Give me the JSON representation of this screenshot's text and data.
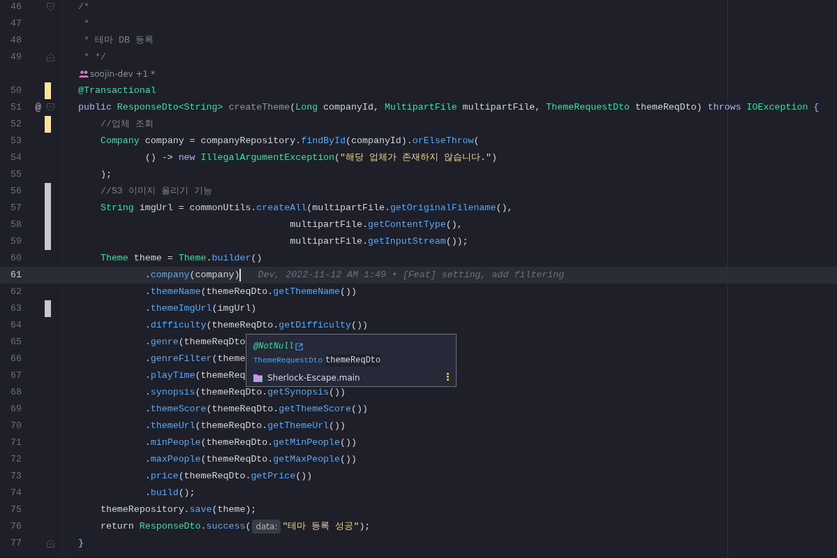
{
  "editor": {
    "lines": [
      {
        "kind": "code",
        "number": "46",
        "fold": {
          "kind": "start"
        },
        "current": false,
        "tokens": [
          {
            "kind": "comment",
            "text": "/*"
          }
        ]
      },
      {
        "kind": "code",
        "number": "47",
        "current": false,
        "tokens": [
          {
            "kind": "comment",
            "text": " *"
          }
        ]
      },
      {
        "kind": "code",
        "number": "48",
        "current": false,
        "tokens": [
          {
            "kind": "comment",
            "text": " * 테마 DB 등록"
          }
        ]
      },
      {
        "kind": "code",
        "number": "49",
        "fold": {
          "kind": "end"
        },
        "current": false,
        "tokens": [
          {
            "kind": "comment",
            "text": " * */"
          }
        ]
      },
      {
        "kind": "author",
        "text": "soojin-dev +1 *"
      },
      {
        "kind": "code",
        "number": "50",
        "change": {
          "color": "#fde29a"
        },
        "current": false,
        "tokens": [
          {
            "kind": "annotation",
            "text": "@Transactional"
          }
        ]
      },
      {
        "kind": "code",
        "number": "51",
        "marker": "@",
        "fold": {
          "kind": "start"
        },
        "current": false,
        "tokens": [
          {
            "kind": "keyword",
            "text": "public "
          },
          {
            "kind": "type",
            "text": "ResponseDto<String>"
          },
          {
            "kind": "declaration",
            "text": " createTheme"
          },
          {
            "kind": "plain",
            "text": "("
          },
          {
            "kind": "type",
            "text": "Long"
          },
          {
            "kind": "plain",
            "text": " companyId, "
          },
          {
            "kind": "type",
            "text": "MultipartFile"
          },
          {
            "kind": "plain",
            "text": " multipartFile, "
          },
          {
            "kind": "type",
            "text": "ThemeRequestDto"
          },
          {
            "kind": "plain",
            "text": " themeReqDto) "
          },
          {
            "kind": "keyword",
            "text": "throws "
          },
          {
            "kind": "type",
            "text": "IOException"
          },
          {
            "kind": "keyword",
            "text": " {"
          }
        ]
      },
      {
        "kind": "code",
        "number": "52",
        "change": {
          "color": "#fde29a"
        },
        "current": false,
        "tokens": [
          {
            "kind": "comment",
            "text": "    //업체 조회"
          }
        ]
      },
      {
        "kind": "code",
        "number": "53",
        "current": false,
        "tokens": [
          {
            "kind": "type",
            "text": "    Company"
          },
          {
            "kind": "plain",
            "text": " company = companyRepository."
          },
          {
            "kind": "method",
            "text": "findById"
          },
          {
            "kind": "plain",
            "text": "(companyId)."
          },
          {
            "kind": "method",
            "text": "orElseThrow"
          },
          {
            "kind": "plain",
            "text": "("
          }
        ]
      },
      {
        "kind": "code",
        "number": "54",
        "current": false,
        "tokens": [
          {
            "kind": "plain",
            "text": "            () -> "
          },
          {
            "kind": "keyword",
            "text": "new "
          },
          {
            "kind": "type",
            "text": "IllegalArgumentException"
          },
          {
            "kind": "plain",
            "text": "("
          },
          {
            "kind": "string",
            "text": "\"해당 업체가 존재하지 않습니다.\""
          },
          {
            "kind": "plain",
            "text": ")"
          }
        ]
      },
      {
        "kind": "code",
        "number": "55",
        "current": false,
        "tokens": [
          {
            "kind": "plain",
            "text": "    );"
          }
        ]
      },
      {
        "kind": "code",
        "number": "56",
        "change": {
          "color": "#c7c9cc"
        },
        "current": false,
        "tokens": [
          {
            "kind": "comment",
            "text": "    //S3 이미지 올리기 기능"
          }
        ]
      },
      {
        "kind": "code",
        "number": "57",
        "change": {
          "color": "#c7c9cc"
        },
        "current": false,
        "tokens": [
          {
            "kind": "type",
            "text": "    String"
          },
          {
            "kind": "plain",
            "text": " imgUrl = commonUtils."
          },
          {
            "kind": "method",
            "text": "createAll"
          },
          {
            "kind": "plain",
            "text": "(multipartFile."
          },
          {
            "kind": "method",
            "text": "getOriginalFilename"
          },
          {
            "kind": "plain",
            "text": "(),"
          }
        ]
      },
      {
        "kind": "code",
        "number": "58",
        "change": {
          "color": "#c7c9cc"
        },
        "current": false,
        "tokens": [
          {
            "kind": "plain",
            "text": "                                      multipartFile."
          },
          {
            "kind": "method",
            "text": "getContentType"
          },
          {
            "kind": "plain",
            "text": "(),"
          }
        ]
      },
      {
        "kind": "code",
        "number": "59",
        "change": {
          "color": "#c7c9cc"
        },
        "current": false,
        "tokens": [
          {
            "kind": "plain",
            "text": "                                      multipartFile."
          },
          {
            "kind": "method",
            "text": "getInputStream"
          },
          {
            "kind": "plain",
            "text": "());"
          }
        ]
      },
      {
        "kind": "code",
        "number": "60",
        "current": false,
        "tokens": [
          {
            "kind": "type",
            "text": "    Theme"
          },
          {
            "kind": "plain",
            "text": " theme = "
          },
          {
            "kind": "type",
            "text": "Theme"
          },
          {
            "kind": "plain",
            "text": "."
          },
          {
            "kind": "method",
            "text": "builder"
          },
          {
            "kind": "plain",
            "text": "()"
          }
        ]
      },
      {
        "kind": "code",
        "number": "61",
        "current": true,
        "blame": "Dev, 2022-11-12 AM 1:49 • [Feat] setting, add filtering",
        "tokens": [
          {
            "kind": "plain",
            "text": "            ."
          },
          {
            "kind": "method",
            "text": "company"
          },
          {
            "kind": "plain",
            "text": "(company)"
          }
        ]
      },
      {
        "kind": "code",
        "number": "62",
        "current": false,
        "tokens": [
          {
            "kind": "plain",
            "text": "            ."
          },
          {
            "kind": "method",
            "text": "themeName"
          },
          {
            "kind": "plain",
            "text": "(themeReqDto."
          },
          {
            "kind": "method",
            "text": "getThemeName"
          },
          {
            "kind": "plain",
            "text": "())"
          }
        ]
      },
      {
        "kind": "code",
        "number": "63",
        "change": {
          "color": "#c7c9cc"
        },
        "current": false,
        "tokens": [
          {
            "kind": "plain",
            "text": "            ."
          },
          {
            "kind": "method",
            "text": "themeImgUrl"
          },
          {
            "kind": "plain",
            "text": "(imgUrl)"
          }
        ]
      },
      {
        "kind": "code",
        "number": "64",
        "current": false,
        "tokens": [
          {
            "kind": "plain",
            "text": "            ."
          },
          {
            "kind": "method",
            "text": "difficulty"
          },
          {
            "kind": "plain",
            "text": "(themeReqDto."
          },
          {
            "kind": "method",
            "text": "getDifficulty"
          },
          {
            "kind": "plain",
            "text": "())"
          }
        ]
      },
      {
        "kind": "code",
        "number": "65",
        "current": false,
        "tokens": [
          {
            "kind": "plain",
            "text": "            ."
          },
          {
            "kind": "method",
            "text": "genre"
          },
          {
            "kind": "plain",
            "text": "(themeReqDto"
          }
        ]
      },
      {
        "kind": "code",
        "number": "66",
        "current": false,
        "tokens": [
          {
            "kind": "plain",
            "text": "            ."
          },
          {
            "kind": "method",
            "text": "genreFilter"
          },
          {
            "kind": "plain",
            "text": "(theme"
          }
        ]
      },
      {
        "kind": "code",
        "number": "67",
        "current": false,
        "tokens": [
          {
            "kind": "plain",
            "text": "            ."
          },
          {
            "kind": "method",
            "text": "playTime"
          },
          {
            "kind": "plain",
            "text": "(themeReq"
          }
        ]
      },
      {
        "kind": "code",
        "number": "68",
        "current": false,
        "tokens": [
          {
            "kind": "plain",
            "text": "            ."
          },
          {
            "kind": "method",
            "text": "synopsis"
          },
          {
            "kind": "plain",
            "text": "(themeReqDto."
          },
          {
            "kind": "method",
            "text": "getSynopsis"
          },
          {
            "kind": "plain",
            "text": "())"
          }
        ]
      },
      {
        "kind": "code",
        "number": "69",
        "current": false,
        "tokens": [
          {
            "kind": "plain",
            "text": "            ."
          },
          {
            "kind": "method",
            "text": "themeScore"
          },
          {
            "kind": "plain",
            "text": "(themeReqDto."
          },
          {
            "kind": "method",
            "text": "getThemeScore"
          },
          {
            "kind": "plain",
            "text": "())"
          }
        ]
      },
      {
        "kind": "code",
        "number": "70",
        "current": false,
        "tokens": [
          {
            "kind": "plain",
            "text": "            ."
          },
          {
            "kind": "method",
            "text": "themeUrl"
          },
          {
            "kind": "plain",
            "text": "(themeReqDto."
          },
          {
            "kind": "method",
            "text": "getThemeUrl"
          },
          {
            "kind": "plain",
            "text": "())"
          }
        ]
      },
      {
        "kind": "code",
        "number": "71",
        "current": false,
        "tokens": [
          {
            "kind": "plain",
            "text": "            ."
          },
          {
            "kind": "method",
            "text": "minPeople"
          },
          {
            "kind": "plain",
            "text": "(themeReqDto."
          },
          {
            "kind": "method",
            "text": "getMinPeople"
          },
          {
            "kind": "plain",
            "text": "())"
          }
        ]
      },
      {
        "kind": "code",
        "number": "72",
        "current": false,
        "tokens": [
          {
            "kind": "plain",
            "text": "            ."
          },
          {
            "kind": "method",
            "text": "maxPeople"
          },
          {
            "kind": "plain",
            "text": "(themeReqDto."
          },
          {
            "kind": "method",
            "text": "getMaxPeople"
          },
          {
            "kind": "plain",
            "text": "())"
          }
        ]
      },
      {
        "kind": "code",
        "number": "73",
        "current": false,
        "tokens": [
          {
            "kind": "plain",
            "text": "            ."
          },
          {
            "kind": "method",
            "text": "price"
          },
          {
            "kind": "plain",
            "text": "(themeReqDto."
          },
          {
            "kind": "method",
            "text": "getPrice"
          },
          {
            "kind": "plain",
            "text": "())"
          }
        ]
      },
      {
        "kind": "code",
        "number": "74",
        "current": false,
        "tokens": [
          {
            "kind": "plain",
            "text": "            ."
          },
          {
            "kind": "method",
            "text": "build"
          },
          {
            "kind": "plain",
            "text": "();"
          }
        ]
      },
      {
        "kind": "code",
        "number": "75",
        "current": false,
        "tokens": [
          {
            "kind": "plain",
            "text": "    themeRepository."
          },
          {
            "kind": "method",
            "text": "save"
          },
          {
            "kind": "plain",
            "text": "(theme);"
          }
        ]
      },
      {
        "kind": "code",
        "number": "76",
        "current": false,
        "tokens": [
          {
            "kind": "plain",
            "text": "    return "
          },
          {
            "kind": "type",
            "text": "ResponseDto"
          },
          {
            "kind": "plain",
            "text": "."
          },
          {
            "kind": "method",
            "text": "success"
          },
          {
            "kind": "plain",
            "text": "("
          },
          {
            "kind": "hint",
            "text": "data:"
          },
          {
            "kind": "string",
            "text": "\"테마 등록 성공\""
          },
          {
            "kind": "plain",
            "text": ");"
          }
        ]
      },
      {
        "kind": "code",
        "number": "77",
        "fold": {
          "kind": "end"
        },
        "current": false,
        "tokens": [
          {
            "kind": "keyword",
            "text": "}"
          }
        ]
      }
    ]
  },
  "popup": {
    "annotation": "@NotNull",
    "param_type": "ThemeRequestDto",
    "param_name": "themeReqDto",
    "module": "Sherlock-Escape.main"
  }
}
